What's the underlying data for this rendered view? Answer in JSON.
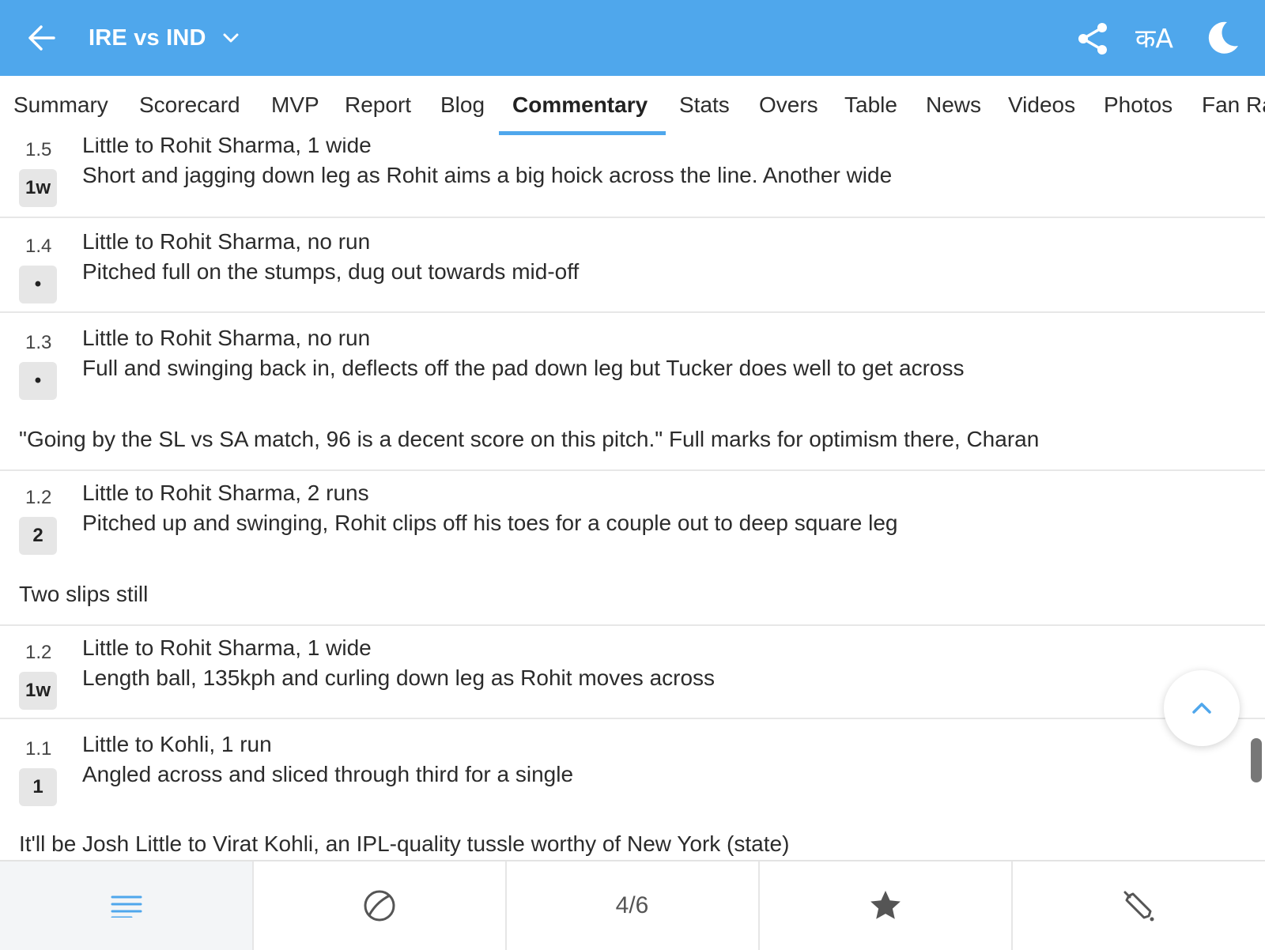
{
  "header": {
    "title": "IRE vs IND",
    "lang_label": "कA",
    "accent": "#4fa7ec"
  },
  "tabs": [
    {
      "label": "Summary"
    },
    {
      "label": "Scorecard"
    },
    {
      "label": "MVP"
    },
    {
      "label": "Report"
    },
    {
      "label": "Blog"
    },
    {
      "label": "Commentary",
      "active": true
    },
    {
      "label": "Stats"
    },
    {
      "label": "Overs"
    },
    {
      "label": "Table"
    },
    {
      "label": "News"
    },
    {
      "label": "Videos"
    },
    {
      "label": "Photos"
    },
    {
      "label": "Fan Ra"
    }
  ],
  "commentary": [
    {
      "over": "1.5",
      "badge": "1w",
      "headline": "Little to Rohit Sharma, 1 wide",
      "text": "Short and jagging down leg as Rohit aims a big hoick across the line. Another wide"
    },
    {
      "over": "1.4",
      "badge": "•",
      "headline": "Little to Rohit Sharma, no run",
      "text": "Pitched full on the stumps, dug out towards mid-off"
    },
    {
      "over": "1.3",
      "badge": "•",
      "headline": "Little to Rohit Sharma, no run",
      "text": "Full and swinging back in, deflects off the pad down leg but Tucker does well to get across"
    },
    {
      "note": "\"Going by the SL vs SA match, 96 is a decent score on this pitch.\" Full marks for optimism there, Charan"
    },
    {
      "over": "1.2",
      "badge": "2",
      "headline": "Little to Rohit Sharma, 2 runs",
      "text": "Pitched up and swinging, Rohit clips off his toes for a couple out to deep square leg"
    },
    {
      "note": "Two slips still"
    },
    {
      "over": "1.2",
      "badge": "1w",
      "headline": "Little to Rohit Sharma, 1 wide",
      "text": "Length ball, 135kph and curling down leg as Rohit moves across"
    },
    {
      "over": "1.1",
      "badge": "1",
      "headline": "Little to Kohli, 1 run",
      "text": "Angled across and sliced through third for a single"
    },
    {
      "note": "It'll be Josh Little to Virat Kohli, an IPL-quality tussle worthy of New York (state)"
    }
  ],
  "bottom_nav": {
    "items": [
      {
        "icon": "menu-icon"
      },
      {
        "icon": "ball-icon"
      },
      {
        "label": "4/6"
      },
      {
        "icon": "star-icon"
      },
      {
        "icon": "bat-icon"
      }
    ]
  }
}
